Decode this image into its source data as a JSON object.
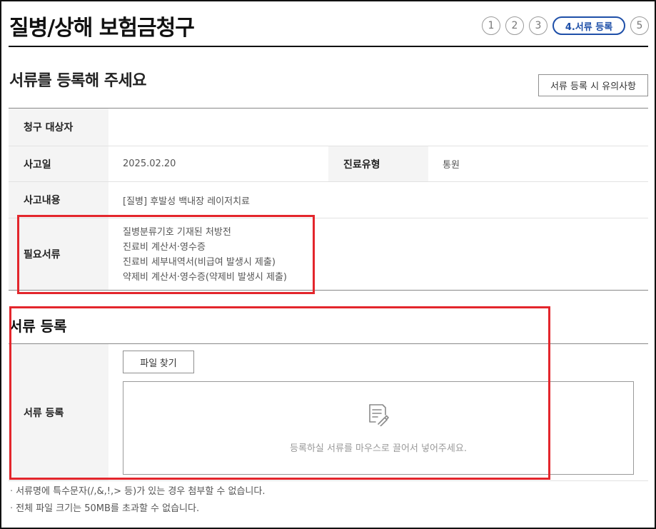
{
  "header": {
    "title": "질병/상해 보험금청구",
    "steps": [
      {
        "label": "1"
      },
      {
        "label": "2"
      },
      {
        "label": "3"
      },
      {
        "label": "4.서류 등록"
      },
      {
        "label": "5"
      }
    ]
  },
  "section": {
    "title": "서류를 등록해 주세요",
    "notice_button": "서류 등록 시 유의사항"
  },
  "info": {
    "claimant_label": "청구 대상자",
    "claimant_value": "",
    "accident_date_label": "사고일",
    "accident_date_value": "2025.02.20",
    "treatment_type_label": "진료유형",
    "treatment_type_value": "통원",
    "accident_detail_label": "사고내용",
    "accident_detail_value": "[질병] 후발성 백내장 레이저치료",
    "required_docs_label": "필요서류",
    "required_docs": [
      "질병분류기호 기재된 처방전",
      "진료비 계산서·영수증",
      "진료비 세부내역서(비급여 발생시 제출)",
      "약제비 계산서·영수증(약제비 발생시 제출)"
    ]
  },
  "register": {
    "title": "서류 등록",
    "row_label": "서류 등록",
    "file_button": "파일 찾기",
    "drop_text": "등록하실 서류를 마우스로 끌어서 넣어주세요.",
    "drop_icon": "document-icon"
  },
  "notes": [
    "서류명에 특수문자(/,&,!,> 등)가 있는 경우 첨부할 수 없습니다.",
    "전체 파일 크기는 50MB를 초과할 수 없습니다."
  ],
  "colors": {
    "accent": "#1e4fa8",
    "highlight": "#e3262c"
  }
}
